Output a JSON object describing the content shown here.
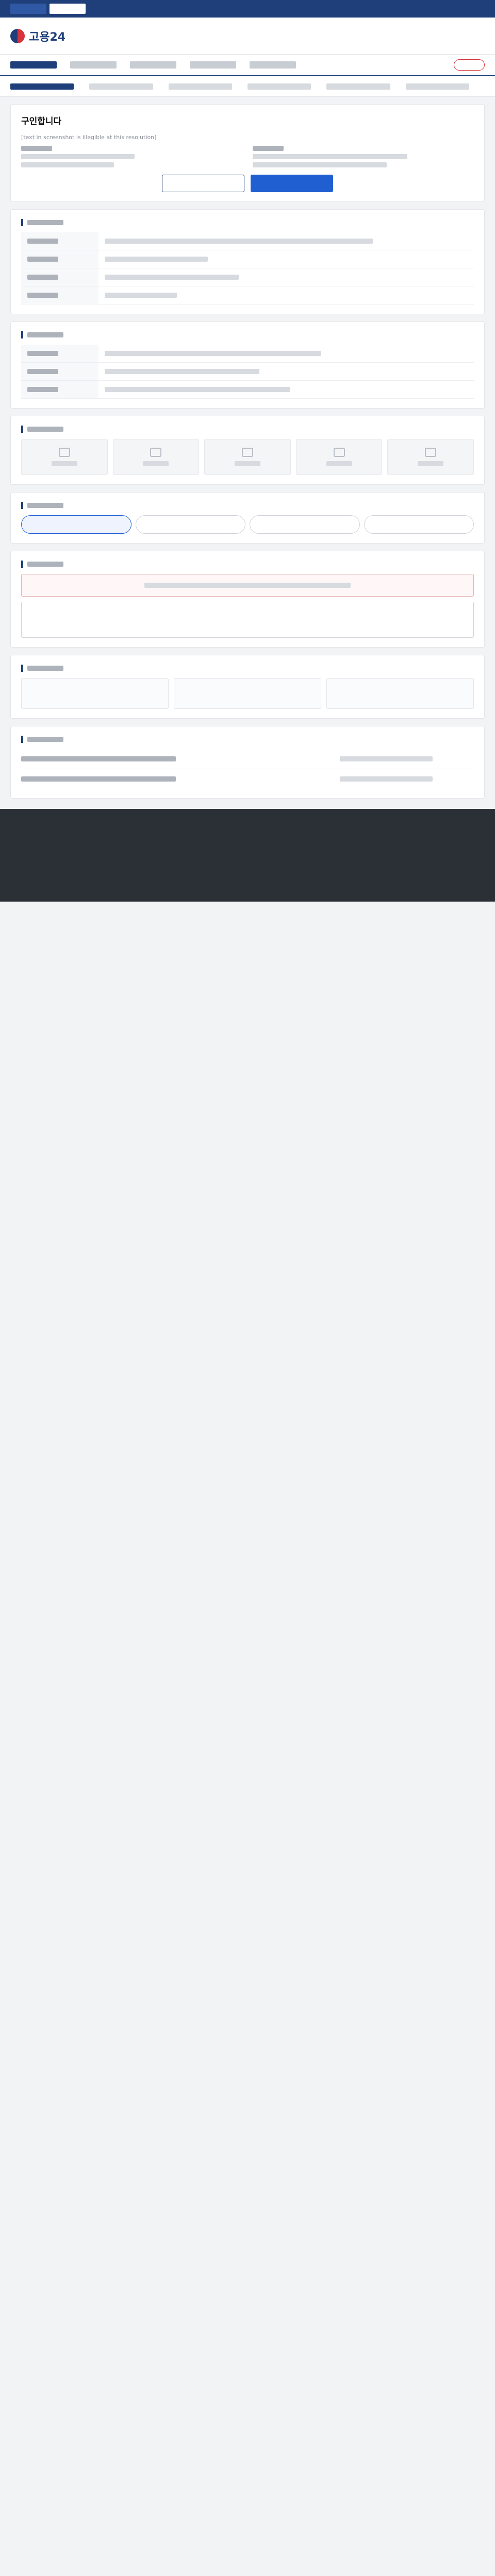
{
  "brand": {
    "logo_text": "고용24",
    "accent": "#1f3f7a",
    "highlight": "#1f5fd1",
    "alert": "#d6333c"
  },
  "job": {
    "title_fragment": "구인합니다"
  },
  "notes": {
    "unreadable": "[text in screenshot is illegible at this resolution]"
  }
}
